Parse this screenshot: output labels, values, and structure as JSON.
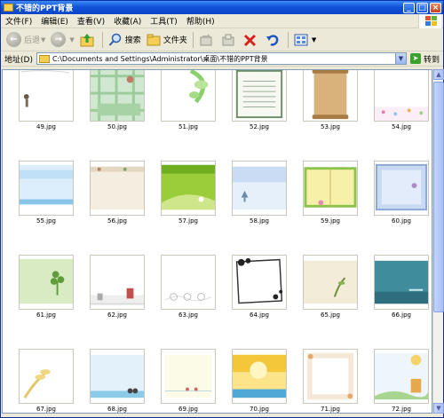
{
  "window": {
    "title": "不错的PPT背景",
    "title_buttons": {
      "minimize": "_",
      "maximize": "□",
      "close": "×"
    }
  },
  "menu": [
    "文件(F)",
    "编辑(E)",
    "查看(V)",
    "收藏(A)",
    "工具(T)",
    "帮助(H)"
  ],
  "toolbar": {
    "back_label": "后退",
    "search_label": "搜索",
    "folders_label": "文件夹",
    "icons": [
      "back-icon",
      "forward-icon",
      "up-folder-icon",
      "search-icon",
      "folders-icon",
      "move-to-icon",
      "copy-to-icon",
      "delete-icon",
      "undo-icon",
      "views-icon"
    ]
  },
  "address": {
    "label": "地址(D)",
    "path": "C:\\Documents and Settings\\Administrator\\桌面\\不错的PPT背景",
    "go_label": "转到"
  },
  "files": [
    "49.jpg",
    "50.jpg",
    "51.jpg",
    "52.jpg",
    "53.jpg",
    "54.jpg",
    "55.jpg",
    "56.jpg",
    "57.jpg",
    "58.jpg",
    "59.jpg",
    "60.jpg",
    "61.jpg",
    "62.jpg",
    "63.jpg",
    "64.jpg",
    "65.jpg",
    "66.jpg",
    "67.jpg",
    "68.jpg",
    "69.jpg",
    "70.jpg",
    "71.jpg",
    "72.jpg"
  ],
  "colors": {
    "titlebar": "#1153d8",
    "window_bg": "#ece9d8",
    "content_bg": "#ffffff"
  }
}
